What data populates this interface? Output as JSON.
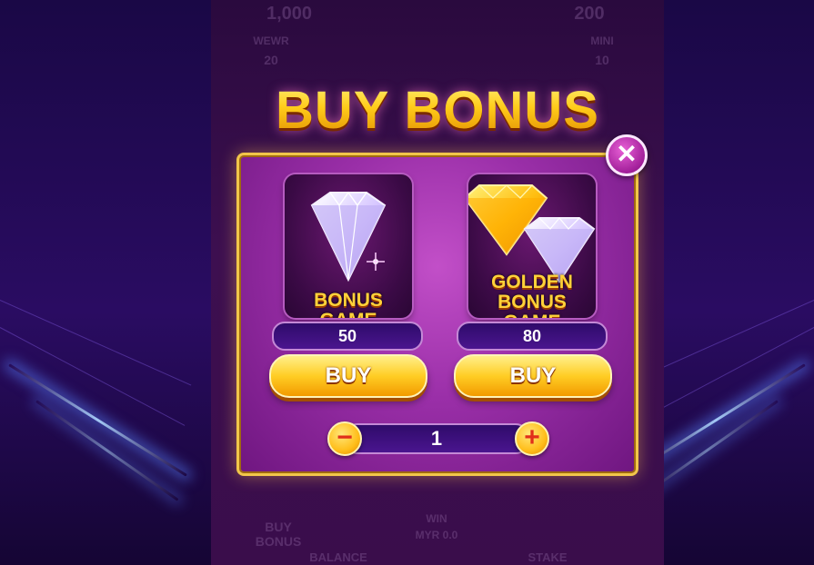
{
  "title": "BUY BONUS",
  "background_labels": {
    "top_left_value": "1,000",
    "top_right_value": "200",
    "left_label": "WEWR",
    "left_value": "20",
    "right_label": "MINI",
    "right_value": "10",
    "buy_bonus_lines": [
      "BUY",
      "BONUS"
    ],
    "win_label": "WIN",
    "win_value": "MYR 0.0",
    "balance_label": "BALANCE",
    "stake_label": "STAKE"
  },
  "cards": [
    {
      "label_lines": [
        "BONUS GAME"
      ],
      "price": "50",
      "buy_label": "BUY"
    },
    {
      "label_lines": [
        "GOLDEN",
        "BONUS GAME"
      ],
      "price": "80",
      "buy_label": "BUY"
    }
  ],
  "quantity": {
    "value": "1",
    "minus": "−",
    "plus": "+"
  },
  "close_symbol": "✕",
  "colors": {
    "gold": "#ffcd24",
    "panel_purple": "#9a2fa8",
    "pill_purple": "#3d1180",
    "diamond_white": "#e8dcff",
    "diamond_gold": "#ffb400"
  },
  "icons": [
    "white-diamond-icon",
    "gold-diamond-icon",
    "close-icon",
    "minus-icon",
    "plus-icon"
  ]
}
